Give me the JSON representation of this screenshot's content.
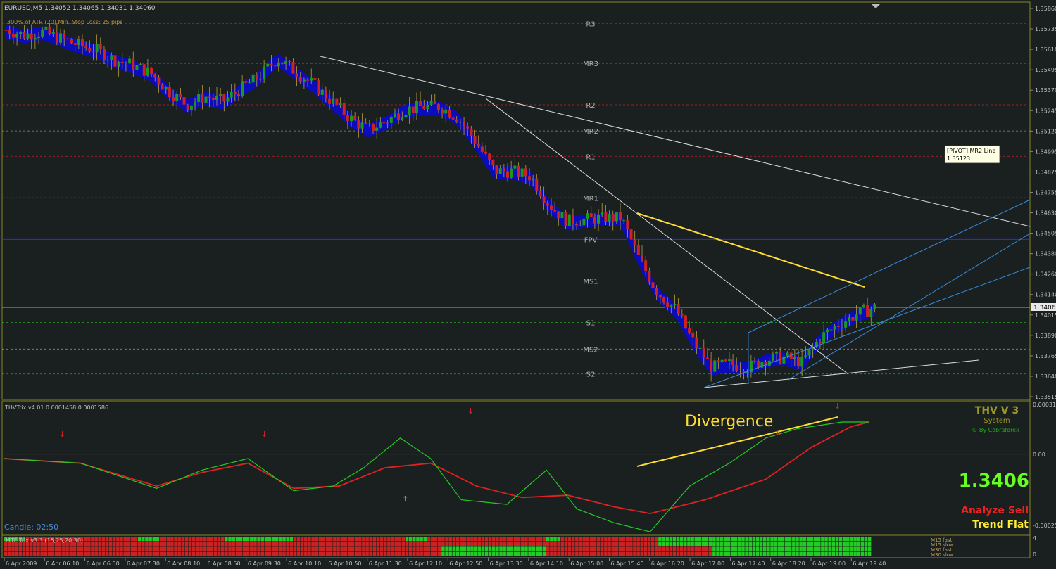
{
  "header": {
    "symbol_line": "EURUSD,M5  1.34052 1.34065 1.34031 1.34060",
    "atr_info": "300% of ATR (20)     Min. Stop Loss:  25 pips"
  },
  "indicator_header": "THVTrix v4.01 0.0001458 0.0001586",
  "tooltip": {
    "line1": "[PIVOT] MR2 Line",
    "line2": "1.35123"
  },
  "price_axis_ticks": [
    "1.35860",
    "1.35735",
    "1.35610",
    "1.35495",
    "1.35370",
    "1.35245",
    "1.35120",
    "1.34995",
    "1.34875",
    "1.34755",
    "1.34630",
    "1.34505",
    "1.34380",
    "1.34260",
    "1.34140",
    "1.34015",
    "1.33890",
    "1.33765",
    "1.33640",
    "1.33515"
  ],
  "current_price_label": "1.34060",
  "indicator_axis": {
    "top": "0.000317",
    "zero": "0.00",
    "bottom": "-0.000252"
  },
  "time_axis_ticks": [
    "6 Apr 2009",
    "6 Apr 06:10",
    "6 Apr 06:50",
    "6 Apr 07:30",
    "6 Apr 08:10",
    "6 Apr 08:50",
    "6 Apr 09:30",
    "6 Apr 10:10",
    "6 Apr 10:50",
    "6 Apr 11:30",
    "6 Apr 12:10",
    "6 Apr 12:50",
    "6 Apr 13:30",
    "6 Apr 14:10",
    "6 Apr 15:00",
    "6 Apr 15:40",
    "6 Apr 16:20",
    "6 Apr 17:00",
    "6 Apr 17:40",
    "6 Apr 18:20",
    "6 Apr 19:00",
    "6 Apr 19:40"
  ],
  "pivot_levels": [
    {
      "label": "R3",
      "price": 1.3577,
      "color": "#cc2222",
      "style": "dash"
    },
    {
      "label": "MR3",
      "price": 1.3553,
      "color": "#888888",
      "style": "dash"
    },
    {
      "label": "R2",
      "price": 1.3528,
      "color": "#cc2222",
      "style": "dash"
    },
    {
      "label": "MR2",
      "price": 1.35123,
      "color": "#888888",
      "style": "dash"
    },
    {
      "label": "R1",
      "price": 1.3497,
      "color": "#cc2222",
      "style": "dash"
    },
    {
      "label": "MR1",
      "price": 1.3472,
      "color": "#888888",
      "style": "dash"
    },
    {
      "label": "FPV",
      "price": 1.3447,
      "color": "#2a2aff",
      "style": "solid"
    },
    {
      "label": "MS1",
      "price": 1.3422,
      "color": "#888888",
      "style": "dash"
    },
    {
      "label": "S1",
      "price": 1.3397,
      "color": "#22aa22",
      "style": "dash"
    },
    {
      "label": "MS2",
      "price": 1.3381,
      "color": "#888888",
      "style": "dash"
    },
    {
      "label": "S2",
      "price": 1.3366,
      "color": "#22aa22",
      "style": "dash"
    }
  ],
  "annotations": {
    "divergence": "Divergence",
    "candle_timer": "Candle:  02:50"
  },
  "thv_panel": {
    "title": "THV V 3",
    "subtitle": "System",
    "credit": "© By Cobraforex",
    "price": "1.3406",
    "analyze": "Analyze Sell",
    "trend": "Trend Flat"
  },
  "mtf_bar": {
    "title": "MTF Trix v3.3 (15,25,20,30)",
    "rows": [
      "M15 fast",
      "M15 slow",
      "M30 fast",
      "M30 slow"
    ],
    "axis_top": "4",
    "axis_bottom": "0"
  },
  "chart_data": {
    "type": "candlestick",
    "symbol": "EURUSD",
    "timeframe": "M5",
    "ylim": [
      1.33515,
      1.3586
    ],
    "last": {
      "open": 1.34052,
      "high": 1.34065,
      "low": 1.34031,
      "close": 1.3406
    },
    "close_path": [
      [
        0,
        1.3573
      ],
      [
        10,
        1.357
      ],
      [
        20,
        1.3572
      ],
      [
        30,
        1.3568
      ],
      [
        40,
        1.3564
      ],
      [
        50,
        1.3561
      ],
      [
        60,
        1.3555
      ],
      [
        70,
        1.3552
      ],
      [
        80,
        1.3547
      ],
      [
        90,
        1.3536
      ],
      [
        100,
        1.3528
      ],
      [
        110,
        1.3533
      ],
      [
        120,
        1.353
      ],
      [
        130,
        1.3538
      ],
      [
        140,
        1.3545
      ],
      [
        150,
        1.3556
      ],
      [
        160,
        1.3548
      ],
      [
        170,
        1.354
      ],
      [
        180,
        1.353
      ],
      [
        190,
        1.352
      ],
      [
        200,
        1.3513
      ],
      [
        210,
        1.3518
      ],
      [
        220,
        1.3525
      ],
      [
        230,
        1.3527
      ],
      [
        240,
        1.3527
      ],
      [
        250,
        1.352
      ],
      [
        260,
        1.3505
      ],
      [
        270,
        1.3488
      ],
      [
        280,
        1.3488
      ],
      [
        290,
        1.3485
      ],
      [
        300,
        1.3468
      ],
      [
        310,
        1.3458
      ],
      [
        320,
        1.3459
      ],
      [
        330,
        1.346
      ],
      [
        340,
        1.346
      ],
      [
        350,
        1.3435
      ],
      [
        360,
        1.3415
      ],
      [
        370,
        1.3405
      ],
      [
        380,
        1.3385
      ],
      [
        390,
        1.337
      ],
      [
        400,
        1.3372
      ],
      [
        410,
        1.337
      ],
      [
        420,
        1.3375
      ],
      [
        430,
        1.3376
      ],
      [
        440,
        1.3373
      ],
      [
        450,
        1.3388
      ],
      [
        460,
        1.3396
      ],
      [
        470,
        1.3402
      ],
      [
        480,
        1.3406
      ]
    ],
    "trix_fast": [
      [
        0,
        8e-05
      ],
      [
        25,
        6e-05
      ],
      [
        50,
        -5e-05
      ],
      [
        65,
        3e-05
      ],
      [
        80,
        8e-05
      ],
      [
        95,
        -6e-05
      ],
      [
        108,
        -4e-05
      ],
      [
        118,
        4e-05
      ],
      [
        130,
        0.00017
      ],
      [
        140,
        8e-05
      ],
      [
        150,
        -0.0001
      ],
      [
        165,
        -0.00012
      ],
      [
        178,
        3e-05
      ],
      [
        188,
        -0.00014
      ],
      [
        200,
        -0.0002
      ],
      [
        212,
        -0.00024
      ],
      [
        225,
        -4e-05
      ],
      [
        238,
        6e-05
      ],
      [
        250,
        0.00017
      ],
      [
        260,
        0.00021
      ],
      [
        275,
        0.00024
      ],
      [
        284,
        0.00024
      ]
    ],
    "trix_slow": [
      [
        0,
        8e-05
      ],
      [
        25,
        6e-05
      ],
      [
        50,
        -4e-05
      ],
      [
        65,
        2e-05
      ],
      [
        80,
        6e-05
      ],
      [
        95,
        -5e-05
      ],
      [
        110,
        -4e-05
      ],
      [
        125,
        4e-05
      ],
      [
        140,
        6e-05
      ],
      [
        155,
        -4e-05
      ],
      [
        170,
        -9e-05
      ],
      [
        185,
        -8e-05
      ],
      [
        200,
        -0.00013
      ],
      [
        212,
        -0.00016
      ],
      [
        230,
        -0.0001
      ],
      [
        250,
        -1e-05
      ],
      [
        265,
        0.00013
      ],
      [
        278,
        0.00022
      ],
      [
        284,
        0.00024
      ]
    ]
  },
  "colors": {
    "background": "#1a1f1f",
    "bull_candle": "#1a9a1a",
    "bear_candle": "#cc2222",
    "cloud": "#0a0acc",
    "trix_fast": "#22cc22",
    "trix_slow": "#dd2222",
    "divergence": "#ffdd33",
    "trend_line": "#dddddd",
    "channel": "#3a8adc",
    "border": "#8a8a20"
  }
}
